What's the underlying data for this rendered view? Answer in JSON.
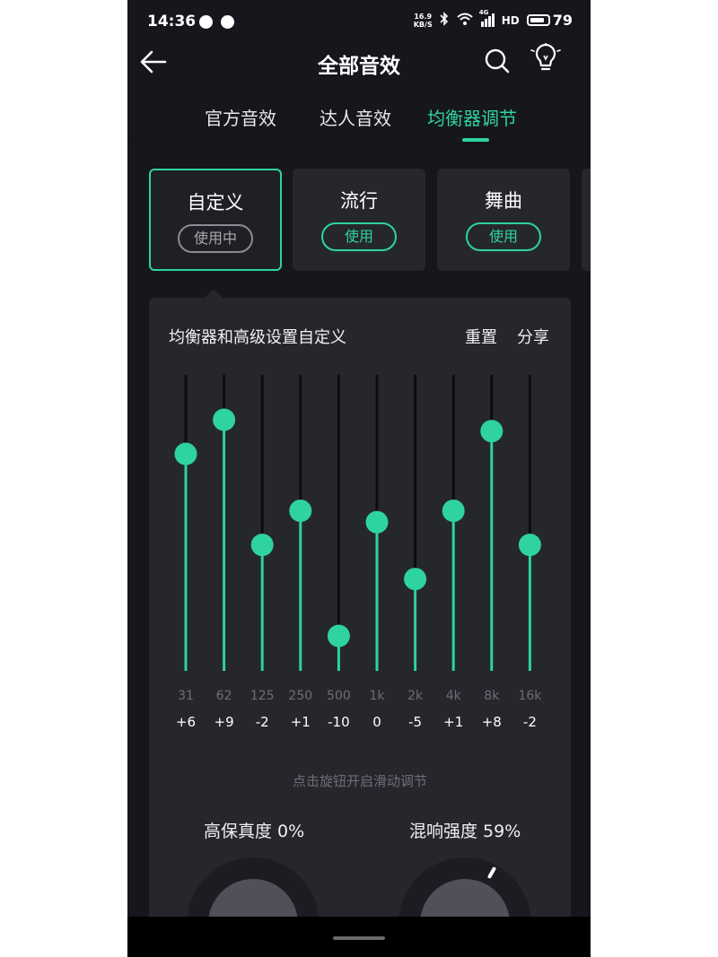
{
  "status_bar": {
    "time": "14:36",
    "net_speed_value": "16.9",
    "net_speed_unit": "KB/S",
    "network": "4G",
    "hd": "HD",
    "battery": "79"
  },
  "header": {
    "title": "全部音效",
    "back_icon": "arrow-left-icon",
    "search_icon": "search-icon",
    "bulb_icon": "lightbulb-icon"
  },
  "tabs": [
    {
      "label": "官方音效",
      "active": false
    },
    {
      "label": "达人音效",
      "active": false
    },
    {
      "label": "均衡器调节",
      "active": true
    }
  ],
  "presets": [
    {
      "name": "自定义",
      "button": "使用中",
      "selected": true
    },
    {
      "name": "流行",
      "button": "使用",
      "selected": false
    },
    {
      "name": "舞曲",
      "button": "使用",
      "selected": false
    }
  ],
  "equalizer": {
    "title": "均衡器和高级设置自定义",
    "reset_label": "重置",
    "share_label": "分享",
    "bands": [
      {
        "freq": "31",
        "gain_label": "+6",
        "gain": 6
      },
      {
        "freq": "62",
        "gain_label": "+9",
        "gain": 9
      },
      {
        "freq": "125",
        "gain_label": "-2",
        "gain": -2
      },
      {
        "freq": "250",
        "gain_label": "+1",
        "gain": 1
      },
      {
        "freq": "500",
        "gain_label": "-10",
        "gain": -10
      },
      {
        "freq": "1k",
        "gain_label": "0",
        "gain": 0
      },
      {
        "freq": "2k",
        "gain_label": "-5",
        "gain": -5
      },
      {
        "freq": "4k",
        "gain_label": "+1",
        "gain": 1
      },
      {
        "freq": "8k",
        "gain_label": "+8",
        "gain": 8
      },
      {
        "freq": "16k",
        "gain_label": "-2",
        "gain": -2
      }
    ],
    "range": [
      -12,
      12
    ],
    "hint": "点击旋钮开启滑动调节"
  },
  "knobs": [
    {
      "label": "高保真度 0%",
      "value": 0
    },
    {
      "label": "混响强度 59%",
      "value": 59
    }
  ],
  "colors": {
    "accent": "#2fd3a0",
    "background": "#16171c",
    "panel": "#26272d"
  }
}
